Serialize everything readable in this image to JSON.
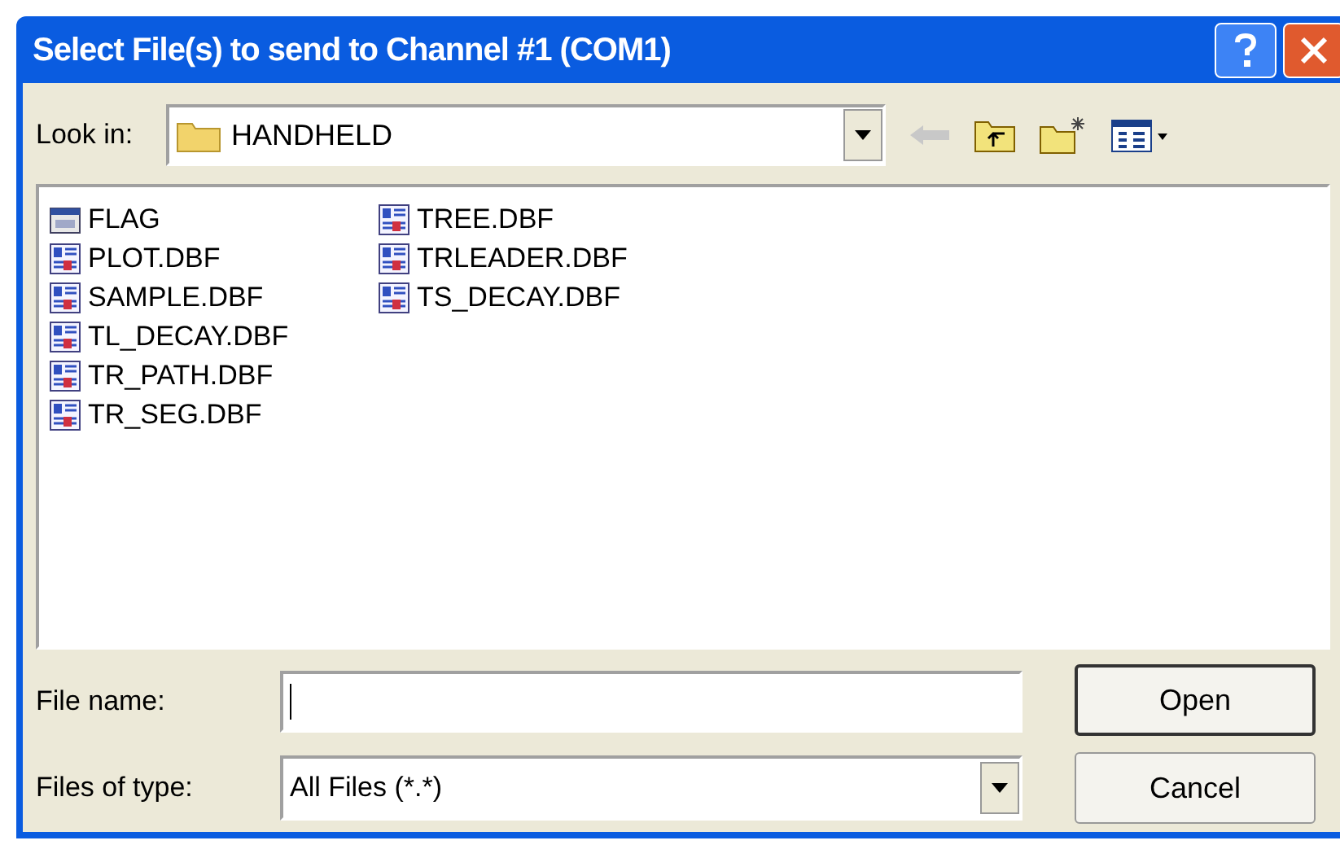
{
  "window": {
    "title": "Select File(s) to send to Channel #1 (COM1)"
  },
  "look_in": {
    "label": "Look in:",
    "value": "HANDHELD"
  },
  "files": [
    {
      "name": "FLAG",
      "kind": "generic"
    },
    {
      "name": "PLOT.DBF",
      "kind": "table"
    },
    {
      "name": "SAMPLE.DBF",
      "kind": "table"
    },
    {
      "name": "TL_DECAY.DBF",
      "kind": "table"
    },
    {
      "name": "TR_PATH.DBF",
      "kind": "table"
    },
    {
      "name": "TR_SEG.DBF",
      "kind": "table"
    },
    {
      "name": "TREE.DBF",
      "kind": "table"
    },
    {
      "name": "TRLEADER.DBF",
      "kind": "table"
    },
    {
      "name": "TS_DECAY.DBF",
      "kind": "table"
    }
  ],
  "file_name": {
    "label": "File name:"
  },
  "file_type": {
    "label": "Files of type:",
    "value": "All Files (*.*)"
  },
  "buttons": [
    "Open",
    "Cancel"
  ]
}
